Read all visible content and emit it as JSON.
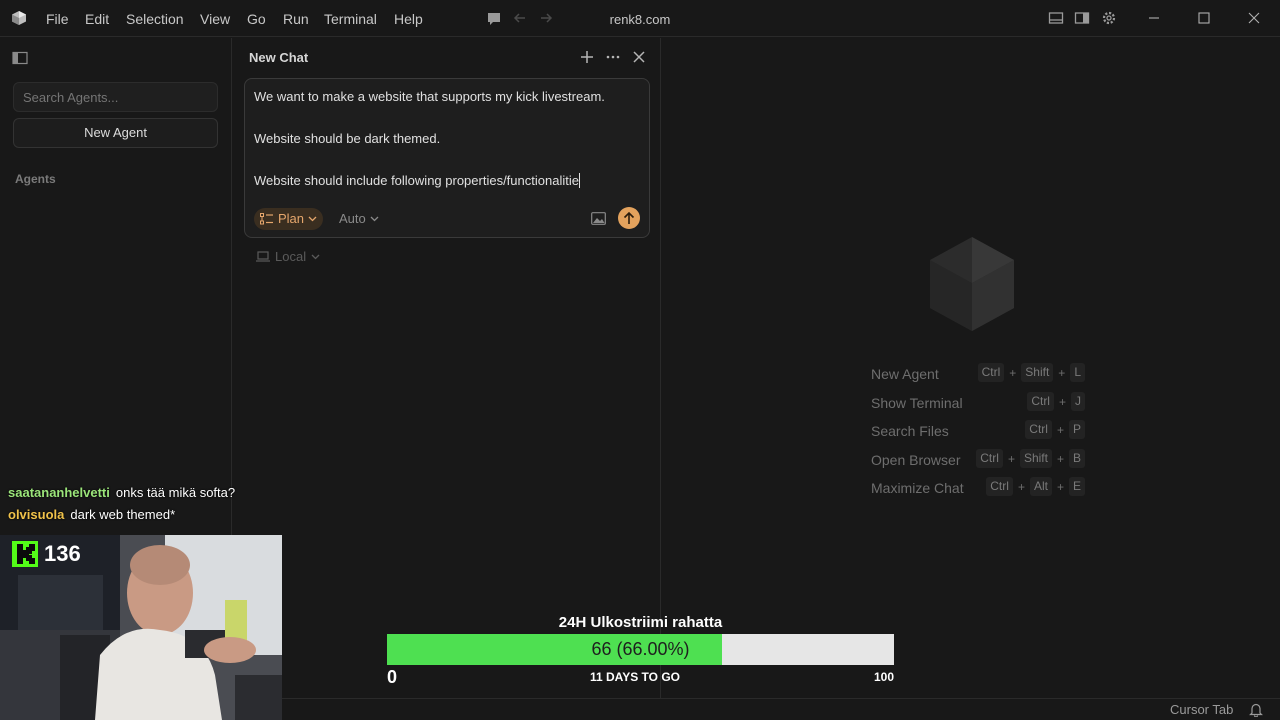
{
  "window": {
    "title": "renk8.com",
    "menu": [
      "File",
      "Edit",
      "Selection",
      "View",
      "Go",
      "Run",
      "Terminal",
      "Help"
    ]
  },
  "sidebar": {
    "search_placeholder": "Search Agents...",
    "new_agent_label": "New Agent",
    "agents_heading": "Agents"
  },
  "chat": {
    "title": "New Chat",
    "composer_lines": [
      "We want to make a website that supports my kick livestream.",
      "Website should be dark themed.",
      "Website should include following properties/functionalitie"
    ],
    "mode_label": "Plan",
    "model_label": "Auto",
    "location_label": "Local"
  },
  "editor": {
    "shortcuts": [
      {
        "label": "New Agent",
        "keys": [
          "Ctrl",
          "Shift",
          "L"
        ]
      },
      {
        "label": "Show Terminal",
        "keys": [
          "Ctrl",
          "J"
        ]
      },
      {
        "label": "Search Files",
        "keys": [
          "Ctrl",
          "P"
        ]
      },
      {
        "label": "Open Browser",
        "keys": [
          "Ctrl",
          "Shift",
          "B"
        ]
      },
      {
        "label": "Maximize Chat",
        "keys": [
          "Ctrl",
          "Alt",
          "E"
        ]
      }
    ]
  },
  "statusbar": {
    "right_label": "Cursor Tab"
  },
  "stream": {
    "chat": [
      {
        "user": "saatananhelvetti",
        "text": "onks tää mikä softa?",
        "color": "#9be57a"
      },
      {
        "user": "olvisuola",
        "text": "dark web themed*",
        "color": "#f0c24a"
      }
    ],
    "kick_count": "136",
    "goal": {
      "title": "24H Ulkostriimi rahatta",
      "value_label": "66 (66.00%)",
      "progress": 0.66,
      "min_label": "0",
      "days_label": "11 DAYS TO GO",
      "max_label": "100"
    }
  },
  "colors": {
    "accent": "#e3a25d",
    "goal_fill": "#4ee051",
    "background": "#181818"
  }
}
